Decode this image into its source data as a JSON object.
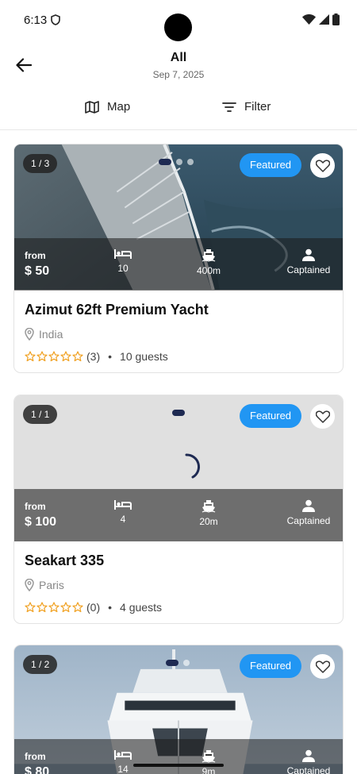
{
  "status_bar": {
    "time": "6:13"
  },
  "header": {
    "title": "All",
    "subtitle": "Sep 7, 2025",
    "back_icon": "arrow-left-icon"
  },
  "toolbar": {
    "map_label": "Map",
    "filter_label": "Filter"
  },
  "colors": {
    "accent": "#2196f3",
    "dot_active": "#1e2a52",
    "star": "#f0a020"
  },
  "listings": [
    {
      "counter": "1 / 3",
      "featured": "Featured",
      "from_label": "from",
      "price": "$ 50",
      "beds": "10",
      "size": "400m",
      "captain": "Captained",
      "title": "Azimut 62ft Premium Yacht",
      "location": "India",
      "reviews": "(3)",
      "guests": "10 guests",
      "rating": 0
    },
    {
      "counter": "1 / 1",
      "featured": "Featured",
      "from_label": "from",
      "price": "$ 100",
      "beds": "4",
      "size": "20m",
      "captain": "Captained",
      "title": "Seakart 335",
      "location": "Paris",
      "reviews": "(0)",
      "guests": "4 guests",
      "rating": 0
    },
    {
      "counter": "1 / 2",
      "featured": "Featured",
      "from_label": "from",
      "price": "$ 80",
      "beds": "14",
      "size": "9m",
      "captain": "Captained"
    }
  ]
}
